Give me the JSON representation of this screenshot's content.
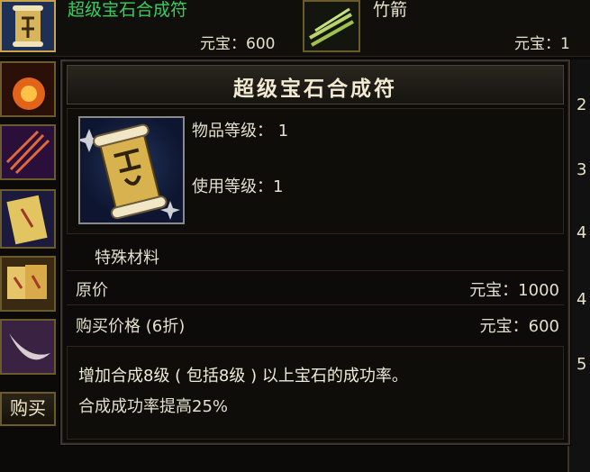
{
  "shop": {
    "top_item_1": {
      "name": "超级宝石合成符",
      "price_label": "元宝：600"
    },
    "top_item_2": {
      "name": "竹箭",
      "price_label": "元宝：1"
    },
    "buy_button": "购买",
    "right_numbers": [
      "2",
      "3",
      "4",
      "4",
      "5"
    ]
  },
  "tooltip": {
    "title": "超级宝石合成符",
    "item_level": "物品等级：  1",
    "use_level": "使用等级：1",
    "category": "特殊材料",
    "original_price_label": "原价",
    "original_price_value": "元宝：1000",
    "purchase_price_label": "购买价格 (6折)",
    "purchase_price_value": "元宝：600",
    "description": "增加合成8级 ( 包括8级 ) 以上宝石的成功率。",
    "effect": "合成成功率提高25%"
  },
  "colors": {
    "green_text": "#34d05c",
    "frame_gold": "#6b5a2c"
  }
}
